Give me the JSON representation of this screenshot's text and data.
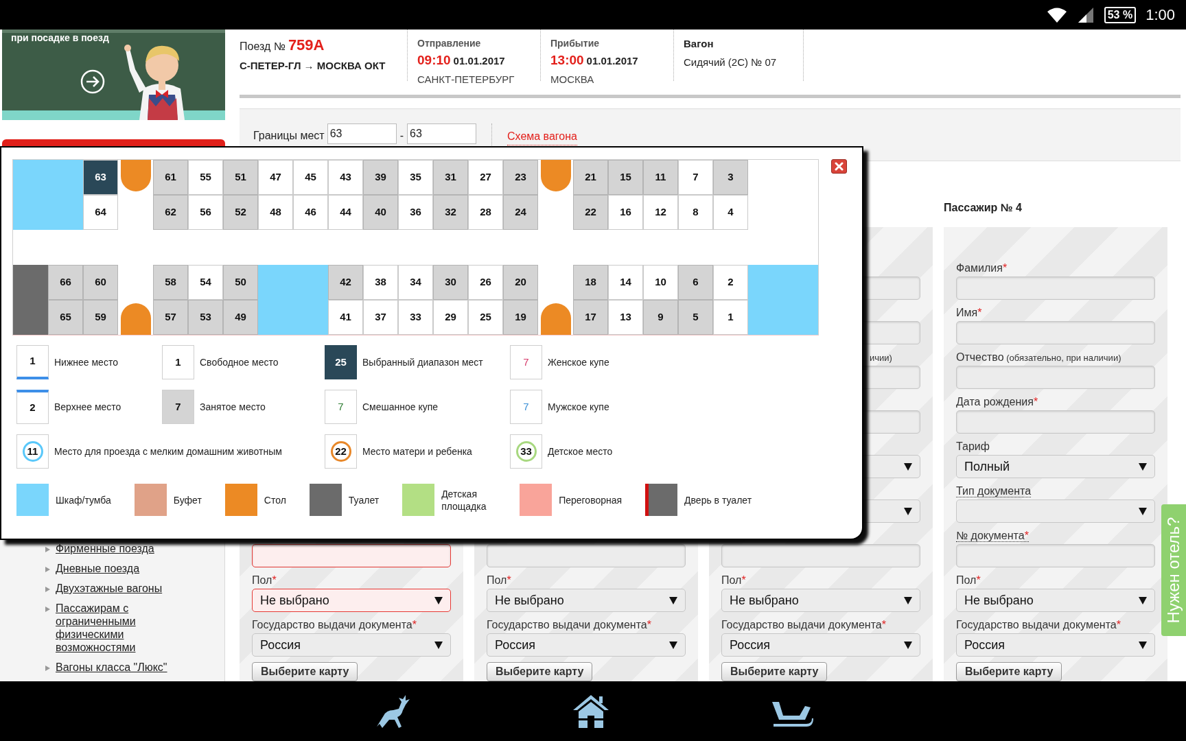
{
  "status_bar": {
    "battery": "53 %",
    "time": "1:00"
  },
  "banner": {
    "caption": "при посадке в поезд"
  },
  "sidebar": {
    "links": [
      "Фирменные поезда",
      "Дневные поезда",
      "Двухэтажные вагоны",
      "Пассажирам с ограниченными физическими возможностями",
      "Вагоны класса \"Люкс\""
    ]
  },
  "train": {
    "label": "Поезд №",
    "number": "759А",
    "route": "С-ПЕТЕР-ГЛ → МОСКВА ОКТ"
  },
  "departure": {
    "label": "Отправление",
    "time": "09:10",
    "date": "01.01.2017",
    "station": "САНКТ-ПЕТЕРБУРГ"
  },
  "arrival": {
    "label": "Прибытие",
    "time": "13:00",
    "date": "01.01.2017",
    "station": "МОСКВА"
  },
  "car": {
    "label": "Вагон",
    "value": "Сидячий (2С) № 07"
  },
  "seat_range": {
    "label": "Границы мест",
    "from": "63",
    "separator": "-",
    "to": "63",
    "scheme_link": "Схема вагона"
  },
  "passengers": [
    {
      "fields": [
        {
          "kind": "input",
          "error": true
        },
        {
          "kind": "select",
          "label": "Пол",
          "mark": "*",
          "dotted": false,
          "value": "Не выбрано",
          "error": true
        },
        {
          "kind": "select",
          "label": "Государство выдачи документа",
          "mark": "*",
          "dotted": false,
          "value": "Россия",
          "error": false
        }
      ],
      "button": "Выберите карту"
    },
    {
      "fields": [
        {
          "kind": "input",
          "error": false
        },
        {
          "kind": "select",
          "label": "Пол",
          "mark": "*",
          "dotted": false,
          "value": "Не выбрано",
          "error": false
        },
        {
          "kind": "select",
          "label": "Государство выдачи документа",
          "mark": "*",
          "dotted": false,
          "value": "Россия",
          "error": false
        }
      ],
      "button": "Выберите карту"
    },
    {
      "fields": [
        {
          "kind": "input",
          "error": false
        },
        {
          "kind": "input",
          "error": false
        },
        {
          "kind": "input",
          "label_fragment": "ичии)",
          "error": false
        },
        {
          "kind": "input",
          "error": false
        },
        {
          "kind": "select",
          "error": false
        },
        {
          "kind": "select",
          "error": false
        },
        {
          "kind": "input",
          "error": false
        },
        {
          "kind": "select",
          "label": "Пол",
          "mark": "*",
          "dotted": false,
          "value": "Не выбрано",
          "error": false
        },
        {
          "kind": "select",
          "label": "Государство выдачи документа",
          "mark": "*",
          "dotted": false,
          "value": "Россия",
          "error": false
        }
      ],
      "button": "Выберите карту"
    },
    {
      "heading": "Пассажир № 4",
      "fields": [
        {
          "kind": "input",
          "label": "Фамилия",
          "mark": "*",
          "dotted": false,
          "error": false
        },
        {
          "kind": "input",
          "label": "Имя",
          "mark": "*",
          "dotted": false,
          "error": false
        },
        {
          "kind": "input",
          "label": "Отчество",
          "note": "(обязательно, при наличии)",
          "dotted": false,
          "error": false
        },
        {
          "kind": "input",
          "label": "Дата рождения",
          "mark": "*",
          "dotted": false,
          "error": false
        },
        {
          "kind": "select",
          "label": "Тариф",
          "dotted": false,
          "value": "Полный",
          "error": false
        },
        {
          "kind": "select",
          "label": "Тип документа",
          "dotted": true,
          "error": false
        },
        {
          "kind": "input",
          "label": "№ документа",
          "mark": "*",
          "dotted": true,
          "error": false
        },
        {
          "kind": "select",
          "label": "Пол",
          "mark": "*",
          "dotted": false,
          "value": "Не выбрано",
          "error": false
        },
        {
          "kind": "select",
          "label": "Государство выдачи документа",
          "mark": "*",
          "dotted": false,
          "value": "Россия",
          "error": false
        }
      ],
      "button": "Выберите карту"
    }
  ],
  "hotel_tab": "Нужен отель?",
  "seat_map": {
    "top": [
      {
        "kind": "cabinet"
      },
      {
        "kind": "cabinet"
      },
      {
        "kind": "seats",
        "seats": [
          {
            "number": "63",
            "selected": true,
            "occupied": false
          },
          {
            "number": "64",
            "selected": false,
            "occupied": false
          }
        ]
      },
      {
        "kind": "table"
      },
      {
        "kind": "seats",
        "seats": [
          {
            "number": "61",
            "selected": false,
            "occupied": true
          },
          {
            "number": "62",
            "selected": false,
            "occupied": true
          }
        ]
      },
      {
        "kind": "seats",
        "seats": [
          {
            "number": "55",
            "selected": false,
            "occupied": false
          },
          {
            "number": "56",
            "selected": false,
            "occupied": false
          }
        ]
      },
      {
        "kind": "seats",
        "seats": [
          {
            "number": "51",
            "selected": false,
            "occupied": true
          },
          {
            "number": "52",
            "selected": false,
            "occupied": true
          }
        ]
      },
      {
        "kind": "seats",
        "seats": [
          {
            "number": "47",
            "selected": false,
            "occupied": false
          },
          {
            "number": "48",
            "selected": false,
            "occupied": false
          }
        ]
      },
      {
        "kind": "seats",
        "seats": [
          {
            "number": "45",
            "selected": false,
            "occupied": false
          },
          {
            "number": "46",
            "selected": false,
            "occupied": false
          }
        ]
      },
      {
        "kind": "seats",
        "seats": [
          {
            "number": "43",
            "selected": false,
            "occupied": false
          },
          {
            "number": "44",
            "selected": false,
            "occupied": false
          }
        ]
      },
      {
        "kind": "seats",
        "seats": [
          {
            "number": "39",
            "selected": false,
            "occupied": true
          },
          {
            "number": "40",
            "selected": false,
            "occupied": true
          }
        ]
      },
      {
        "kind": "seats",
        "seats": [
          {
            "number": "35",
            "selected": false,
            "occupied": false
          },
          {
            "number": "36",
            "selected": false,
            "occupied": false
          }
        ]
      },
      {
        "kind": "seats",
        "seats": [
          {
            "number": "31",
            "selected": false,
            "occupied": true
          },
          {
            "number": "32",
            "selected": false,
            "occupied": true
          }
        ]
      },
      {
        "kind": "seats",
        "seats": [
          {
            "number": "27",
            "selected": false,
            "occupied": false
          },
          {
            "number": "28",
            "selected": false,
            "occupied": false
          }
        ]
      },
      {
        "kind": "seats",
        "seats": [
          {
            "number": "23",
            "selected": false,
            "occupied": true
          },
          {
            "number": "24",
            "selected": false,
            "occupied": true
          }
        ]
      },
      {
        "kind": "table"
      },
      {
        "kind": "seats",
        "seats": [
          {
            "number": "21",
            "selected": false,
            "occupied": true
          },
          {
            "number": "22",
            "selected": false,
            "occupied": true
          }
        ]
      },
      {
        "kind": "seats",
        "seats": [
          {
            "number": "15",
            "selected": false,
            "occupied": true
          },
          {
            "number": "16",
            "selected": false,
            "occupied": false
          }
        ]
      },
      {
        "kind": "seats",
        "seats": [
          {
            "number": "11",
            "selected": false,
            "occupied": true
          },
          {
            "number": "12",
            "selected": false,
            "occupied": false
          }
        ]
      },
      {
        "kind": "seats",
        "seats": [
          {
            "number": "7",
            "selected": false,
            "occupied": false
          },
          {
            "number": "8",
            "selected": false,
            "occupied": false
          }
        ]
      },
      {
        "kind": "seats",
        "seats": [
          {
            "number": "3",
            "selected": false,
            "occupied": true
          },
          {
            "number": "4",
            "selected": false,
            "occupied": false
          }
        ]
      },
      {
        "kind": "empty"
      },
      {
        "kind": "empty"
      }
    ],
    "bottom": [
      {
        "kind": "toilet"
      },
      {
        "kind": "seats",
        "seats": [
          {
            "number": "66",
            "selected": false,
            "occupied": true
          },
          {
            "number": "65",
            "selected": false,
            "occupied": true
          }
        ]
      },
      {
        "kind": "seats",
        "seats": [
          {
            "number": "60",
            "selected": false,
            "occupied": true
          },
          {
            "number": "59",
            "selected": false,
            "occupied": true
          }
        ]
      },
      {
        "kind": "table"
      },
      {
        "kind": "seats",
        "seats": [
          {
            "number": "58",
            "selected": false,
            "occupied": true
          },
          {
            "number": "57",
            "selected": false,
            "occupied": true
          }
        ]
      },
      {
        "kind": "seats",
        "seats": [
          {
            "number": "54",
            "selected": false,
            "occupied": false
          },
          {
            "number": "53",
            "selected": false,
            "occupied": true
          }
        ]
      },
      {
        "kind": "seats",
        "seats": [
          {
            "number": "50",
            "selected": false,
            "occupied": true
          },
          {
            "number": "49",
            "selected": false,
            "occupied": true
          }
        ]
      },
      {
        "kind": "cabinet"
      },
      {
        "kind": "cabinet"
      },
      {
        "kind": "seats",
        "seats": [
          {
            "number": "42",
            "selected": false,
            "occupied": true
          },
          {
            "number": "41",
            "selected": false,
            "occupied": false
          }
        ]
      },
      {
        "kind": "seats",
        "seats": [
          {
            "number": "38",
            "selected": false,
            "occupied": false
          },
          {
            "number": "37",
            "selected": false,
            "occupied": false
          }
        ]
      },
      {
        "kind": "seats",
        "seats": [
          {
            "number": "34",
            "selected": false,
            "occupied": false
          },
          {
            "number": "33",
            "selected": false,
            "occupied": false
          }
        ]
      },
      {
        "kind": "seats",
        "seats": [
          {
            "number": "30",
            "selected": false,
            "occupied": true
          },
          {
            "number": "29",
            "selected": false,
            "occupied": false
          }
        ]
      },
      {
        "kind": "seats",
        "seats": [
          {
            "number": "26",
            "selected": false,
            "occupied": false
          },
          {
            "number": "25",
            "selected": false,
            "occupied": false
          }
        ]
      },
      {
        "kind": "seats",
        "seats": [
          {
            "number": "20",
            "selected": false,
            "occupied": true
          },
          {
            "number": "19",
            "selected": false,
            "occupied": true
          }
        ]
      },
      {
        "kind": "table"
      },
      {
        "kind": "seats",
        "seats": [
          {
            "number": "18",
            "selected": false,
            "occupied": true
          },
          {
            "number": "17",
            "selected": false,
            "occupied": true
          }
        ]
      },
      {
        "kind": "seats",
        "seats": [
          {
            "number": "14",
            "selected": false,
            "occupied": false
          },
          {
            "number": "13",
            "selected": false,
            "occupied": false
          }
        ]
      },
      {
        "kind": "seats",
        "seats": [
          {
            "number": "10",
            "selected": false,
            "occupied": false
          },
          {
            "number": "9",
            "selected": false,
            "occupied": true
          }
        ]
      },
      {
        "kind": "seats",
        "seats": [
          {
            "number": "6",
            "selected": false,
            "occupied": true
          },
          {
            "number": "5",
            "selected": false,
            "occupied": true
          }
        ]
      },
      {
        "kind": "seats",
        "seats": [
          {
            "number": "2",
            "selected": false,
            "occupied": false
          },
          {
            "number": "1",
            "selected": false,
            "occupied": false
          }
        ]
      },
      {
        "kind": "cabinet"
      },
      {
        "kind": "cabinet"
      }
    ]
  },
  "legend": {
    "items": [
      {
        "kind": "lower",
        "sample": "1",
        "label": "Нижнее место"
      },
      {
        "kind": "free",
        "sample": "1",
        "label": "Свободное место"
      },
      {
        "kind": "selected",
        "sample": "25",
        "label": "Выбранный диапазон мест"
      },
      {
        "kind": "female",
        "sample": "7",
        "label": "Женское купе"
      },
      {
        "kind": "upper",
        "sample": "2",
        "label": "Верхнее место"
      },
      {
        "kind": "occupied",
        "sample": "7",
        "label": "Занятое место"
      },
      {
        "kind": "mixed",
        "sample": "7",
        "label": "Смешанное купе"
      },
      {
        "kind": "male",
        "sample": "7",
        "label": "Мужское купе"
      },
      {
        "kind": "pet",
        "sample": "11",
        "label": "Место для проезда с мелким домашним животным"
      },
      {
        "kind": "mother",
        "sample": "22",
        "label": "Место матери и ребенка"
      },
      {
        "kind": "child",
        "sample": "33",
        "label": "Детское место"
      }
    ],
    "areas": [
      {
        "kind": "plain",
        "color": "#7ad6fc",
        "label": "Шкаф/тумба"
      },
      {
        "kind": "plain",
        "color": "#e0a288",
        "label": "Буфет"
      },
      {
        "kind": "plain",
        "color": "#ec8a24",
        "label": "Стол"
      },
      {
        "kind": "plain",
        "color": "#6b6b6b",
        "label": "Туалет"
      },
      {
        "kind": "plain",
        "color": "#b3df84",
        "label": "Детская площадка"
      },
      {
        "kind": "plain",
        "color": "#f9a49a",
        "label": "Переговорная"
      },
      {
        "kind": "door",
        "color": "#6b6b6b",
        "label": "Дверь в туалет"
      }
    ]
  }
}
